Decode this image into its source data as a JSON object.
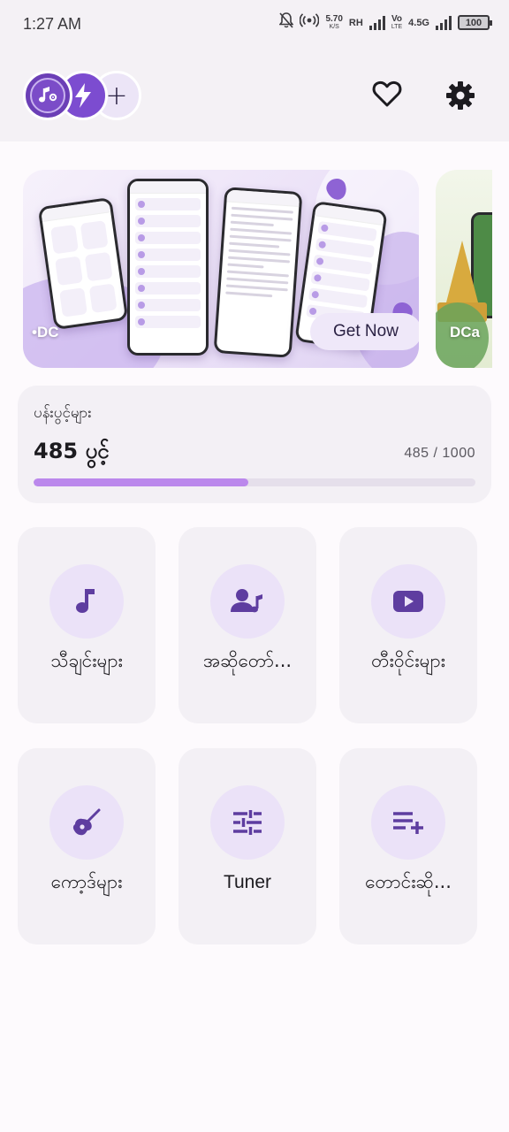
{
  "status_bar": {
    "time": "1:27 AM",
    "net_speed_value": "5.70",
    "net_speed_unit": "K/S",
    "rh_label": "RH",
    "volte_top": "Vo",
    "volte_bottom": "LTE",
    "network_type": "4.5G",
    "battery": "100",
    "icons": [
      "bell-muted-icon",
      "hotspot-icon",
      "signal-icon",
      "battery-icon"
    ]
  },
  "header": {
    "logos": [
      "music-settings-logo",
      "lightning-logo",
      "add-logo"
    ],
    "add_symbol": "+",
    "actions": [
      "heart-icon",
      "gear-icon"
    ]
  },
  "banner": {
    "brand_text": "•DC",
    "cta_label": "Get Now",
    "next_brand_text": "DCa"
  },
  "views": {
    "label": "ပန်းပွင့်များ",
    "count_text": "485 ပွင့်",
    "ratio_text": "485 / 1000",
    "current": 485,
    "max": 1000,
    "progress_fraction": 0.485
  },
  "tiles": [
    {
      "label": "သီချင်းများ",
      "icon": "music-note-icon"
    },
    {
      "label": "အဆိုတော်...",
      "icon": "singer-icon"
    },
    {
      "label": "တီးဝိုင်းများ",
      "icon": "video-icon"
    },
    {
      "label": "ကော့ဒ်များ",
      "icon": "guitar-icon"
    },
    {
      "label": "Tuner",
      "icon": "tuner-sliders-icon"
    },
    {
      "label": "တောင်းဆို...",
      "icon": "playlist-add-icon"
    }
  ],
  "colors": {
    "accent": "#6a45b0",
    "progress_fill": "#bb88ec",
    "tile_background": "#f3f0f5",
    "icon_circle": "#ebe2f8"
  }
}
